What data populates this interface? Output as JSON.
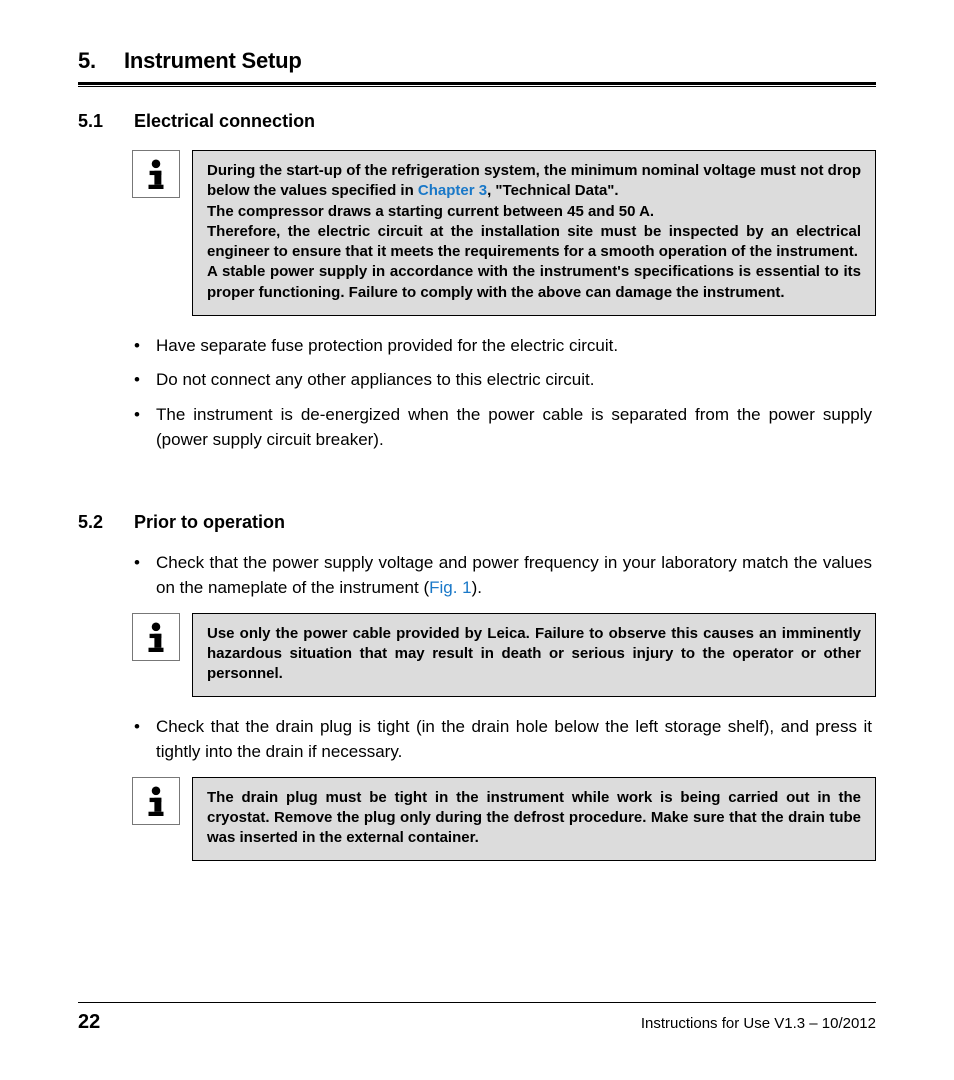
{
  "header": {
    "number": "5.",
    "title": "Instrument Setup"
  },
  "section1": {
    "number": "5.1",
    "title": "Electrical connection",
    "info_p1a": "During the start-up of the refrigeration system, the minimum nominal voltage must not drop below the values specified in ",
    "info_link": "Chapter 3",
    "info_p1b": ", \"Technical Data\".",
    "info_p2": "The compressor draws a starting current between 45 and 50 A.",
    "info_p3": "Therefore, the electric circuit at the installation site must be inspected by an electrical engineer to ensure that it meets the requirements for a smooth operation of the instrument.",
    "info_p4": "A stable power supply in accordance with the instrument's specifications is essential to its proper functioning. Failure to comply with the above can damage the instrument.",
    "bullets": [
      "Have separate fuse protection provided for the electric circuit.",
      "Do not connect any other appliances to this electric circuit.",
      "The instrument is de-energized when the power cable is separated from the power supply (power supply circuit breaker)."
    ]
  },
  "section2": {
    "number": "5.2",
    "title": "Prior to operation",
    "bullet1a": "Check that the power supply voltage and power frequency in your laboratory match the values on the nameplate of the instrument (",
    "bullet1_link": "Fig. 1",
    "bullet1b": ").",
    "info1": "Use only the power cable provided by Leica. Failure to observe this causes an imminently hazardous situation that may result in death or serious injury to the operator or other personnel.",
    "bullet2": "Check that the drain plug is tight (in the drain hole below the left storage shelf), and press it tightly into the drain if necessary.",
    "info2": "The drain plug must be tight in the instrument while work is being carried out in the cryostat. Remove the plug only during the defrost procedure. Make sure that the drain tube was inserted in the external container."
  },
  "footer": {
    "page": "22",
    "text": "Instructions for Use V1.3 – 10/2012"
  }
}
